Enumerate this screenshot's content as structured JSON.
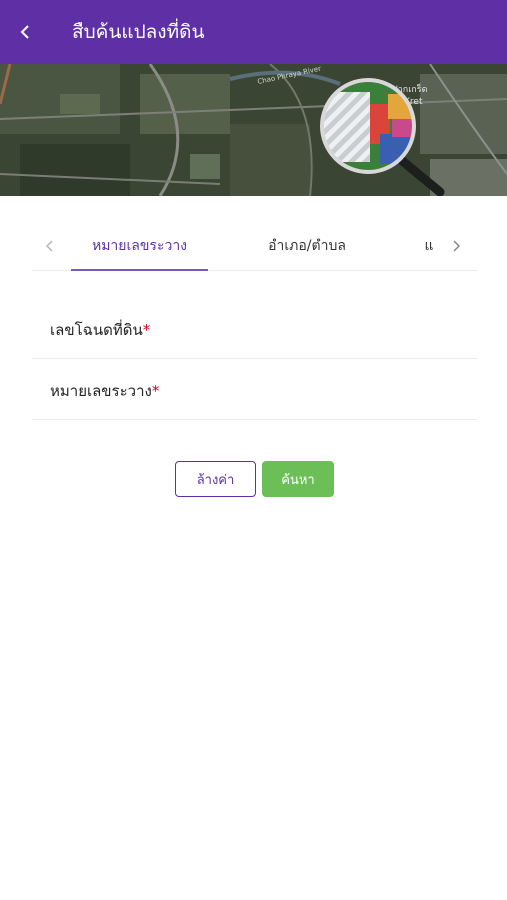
{
  "header": {
    "title": "สืบค้นแปลงที่ดิน",
    "back_icon": "chevron-left-icon"
  },
  "banner": {
    "map_label_river": "Chao Phraya River",
    "map_label_place_th": "ปากเกร็ด",
    "map_label_place_en": "Kret"
  },
  "tabs": {
    "items": [
      {
        "label": "หมายเลขระวาง",
        "active": true
      },
      {
        "label": "อำเภอ/ตำบล",
        "active": false
      },
      {
        "label": "แ",
        "active": false
      }
    ],
    "prev_icon": "chevron-left-icon",
    "next_icon": "chevron-right-icon",
    "accent_color": "#5e2fa5"
  },
  "form": {
    "fields": [
      {
        "label": "เลขโฉนดที่ดิน",
        "required_mark": "*"
      },
      {
        "label": "หมายเลขระวาง",
        "required_mark": "*"
      }
    ]
  },
  "actions": {
    "clear_label": "ล้างค่า",
    "search_label": "ค้นหา",
    "search_color": "#6cbf57"
  }
}
